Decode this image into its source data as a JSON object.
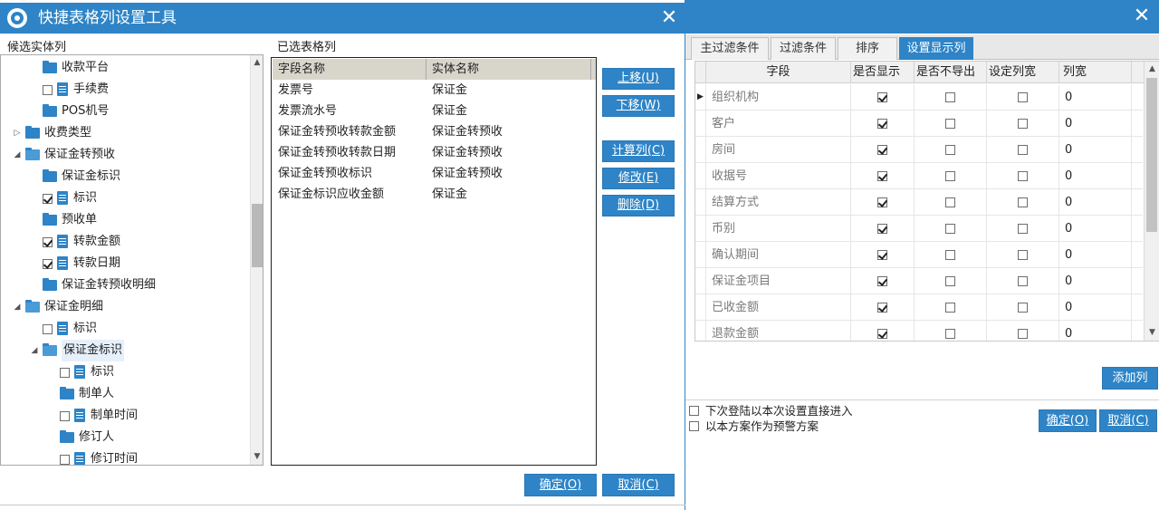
{
  "dialog": {
    "title": "快捷表格列设置工具",
    "close_icon": "close-icon",
    "left_section_label": "候选实体列",
    "right_section_label": "已选表格列"
  },
  "tree": {
    "items": [
      {
        "label": "收款平台",
        "type": "folder",
        "checked": null,
        "expanded": null
      },
      {
        "label": "手续费",
        "type": "doc",
        "checked": false,
        "expanded": null
      },
      {
        "label": "POS机号",
        "type": "folder",
        "checked": null,
        "expanded": null
      },
      {
        "label": "收费类型",
        "type": "folder",
        "checked": null,
        "expanded": false
      },
      {
        "label": "保证金转预收",
        "type": "folder-open",
        "checked": null,
        "expanded": true
      },
      {
        "label": "保证金标识",
        "type": "folder",
        "checked": null,
        "expanded": null
      },
      {
        "label": "标识",
        "type": "doc",
        "checked": true,
        "expanded": null
      },
      {
        "label": "预收单",
        "type": "folder",
        "checked": null,
        "expanded": null
      },
      {
        "label": "转款金额",
        "type": "doc",
        "checked": true,
        "expanded": null
      },
      {
        "label": "转款日期",
        "type": "doc",
        "checked": true,
        "expanded": null
      },
      {
        "label": "保证金转预收明细",
        "type": "folder",
        "checked": null,
        "expanded": null
      },
      {
        "label": "保证金明细",
        "type": "folder-open",
        "checked": null,
        "expanded": true
      },
      {
        "label": "标识",
        "type": "doc",
        "checked": false,
        "expanded": null
      },
      {
        "label": "保证金标识",
        "type": "folder-open",
        "checked": null,
        "expanded": true,
        "selected": true
      },
      {
        "label": "标识",
        "type": "doc",
        "checked": false,
        "expanded": null
      },
      {
        "label": "制单人",
        "type": "folder",
        "checked": null,
        "expanded": null
      },
      {
        "label": "制单时间",
        "type": "doc",
        "checked": false,
        "expanded": null
      },
      {
        "label": "修订人",
        "type": "folder",
        "checked": null,
        "expanded": null
      },
      {
        "label": "修订时间",
        "type": "doc",
        "checked": false,
        "expanded": null
      }
    ]
  },
  "selected_table": {
    "headers": [
      "字段名称",
      "实体名称"
    ],
    "rows": [
      [
        "发票号",
        "保证金"
      ],
      [
        "发票流水号",
        "保证金"
      ],
      [
        "保证金转预收转款金额",
        "保证金转预收"
      ],
      [
        "保证金转预收转款日期",
        "保证金转预收"
      ],
      [
        "保证金转预收标识",
        "保证金转预收"
      ],
      [
        "保证金标识应收金额",
        "保证金"
      ]
    ]
  },
  "side_buttons": {
    "move_up": "上移(U)",
    "move_down": "下移(W)",
    "calc_column": "计算列(C)",
    "edit": "修改(E)",
    "delete": "删除(D)"
  },
  "footer": {
    "ok": "确定(O)",
    "cancel": "取消(C)"
  },
  "background_dialog": {
    "tabs": [
      "主过滤条件",
      "过滤条件",
      "排序",
      "设置显示列"
    ],
    "active_tab": 3,
    "grid_headers": [
      "字段",
      "是否显示",
      "是否不导出",
      "设定列宽",
      "列宽"
    ],
    "grid_rows": [
      {
        "field": "组织机构",
        "show": true,
        "no_export": false,
        "set_width": false,
        "width": "0"
      },
      {
        "field": "客户",
        "show": true,
        "no_export": false,
        "set_width": false,
        "width": "0"
      },
      {
        "field": "房间",
        "show": true,
        "no_export": false,
        "set_width": false,
        "width": "0"
      },
      {
        "field": "收据号",
        "show": true,
        "no_export": false,
        "set_width": false,
        "width": "0"
      },
      {
        "field": "结算方式",
        "show": true,
        "no_export": false,
        "set_width": false,
        "width": "0"
      },
      {
        "field": "币别",
        "show": true,
        "no_export": false,
        "set_width": false,
        "width": "0"
      },
      {
        "field": "确认期间",
        "show": true,
        "no_export": false,
        "set_width": false,
        "width": "0"
      },
      {
        "field": "保证金项目",
        "show": true,
        "no_export": false,
        "set_width": false,
        "width": "0"
      },
      {
        "field": "已收金额",
        "show": true,
        "no_export": false,
        "set_width": false,
        "width": "0"
      },
      {
        "field": "退款金额",
        "show": true,
        "no_export": false,
        "set_width": false,
        "width": "0"
      }
    ],
    "add_column_button": "添加列",
    "option_1": "下次登陆以本次设置直接进入",
    "option_2": "以本方案作为预警方案",
    "ok": "确定(O)",
    "cancel": "取消(C)"
  },
  "colors": {
    "accent": "#2e84c6",
    "table_header": "#d8d5cb"
  }
}
